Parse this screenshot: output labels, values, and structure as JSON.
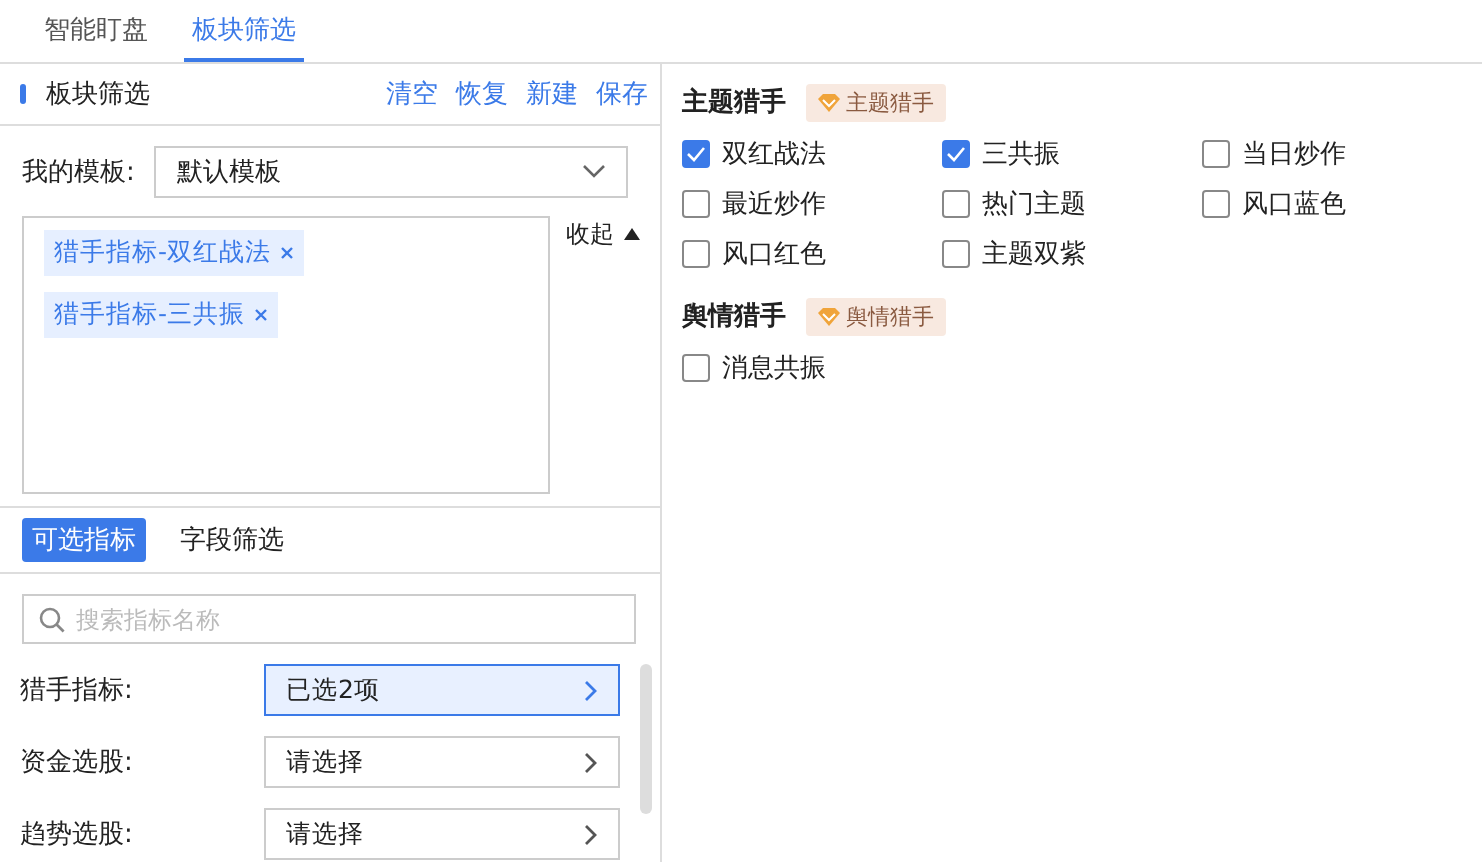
{
  "tabs": [
    {
      "label": "智能盯盘",
      "selected": false
    },
    {
      "label": "板块筛选",
      "selected": true
    }
  ],
  "panel": {
    "title": "板块筛选",
    "actions": [
      "清空",
      "恢复",
      "新建",
      "保存"
    ],
    "template": {
      "label": "我的模板:",
      "value": "默认模板"
    },
    "tags": [
      "猎手指标-双红战法",
      "猎手指标-三共振"
    ],
    "collapse": "收起",
    "subtabs": [
      {
        "label": "可选指标",
        "selected": true
      },
      {
        "label": "字段筛选",
        "selected": false
      }
    ],
    "search": {
      "placeholder": "搜索指标名称"
    },
    "selectors": [
      {
        "label": "猎手指标:",
        "value": "已选2项",
        "selected": true
      },
      {
        "label": "资金选股:",
        "value": "请选择",
        "selected": false
      },
      {
        "label": "趋势选股:",
        "value": "请选择",
        "selected": false
      }
    ]
  },
  "sections": [
    {
      "title": "主题猎手",
      "badge": "主题猎手",
      "options": [
        {
          "label": "双红战法",
          "checked": true
        },
        {
          "label": "三共振",
          "checked": true
        },
        {
          "label": "当日炒作",
          "checked": false
        },
        {
          "label": "最近炒作",
          "checked": false
        },
        {
          "label": "热门主题",
          "checked": false
        },
        {
          "label": "风口蓝色",
          "checked": false
        },
        {
          "label": "风口红色",
          "checked": false
        },
        {
          "label": "主题双紫",
          "checked": false
        }
      ]
    },
    {
      "title": "舆情猎手",
      "badge": "舆情猎手",
      "options": [
        {
          "label": "消息共振",
          "checked": false
        }
      ]
    }
  ]
}
